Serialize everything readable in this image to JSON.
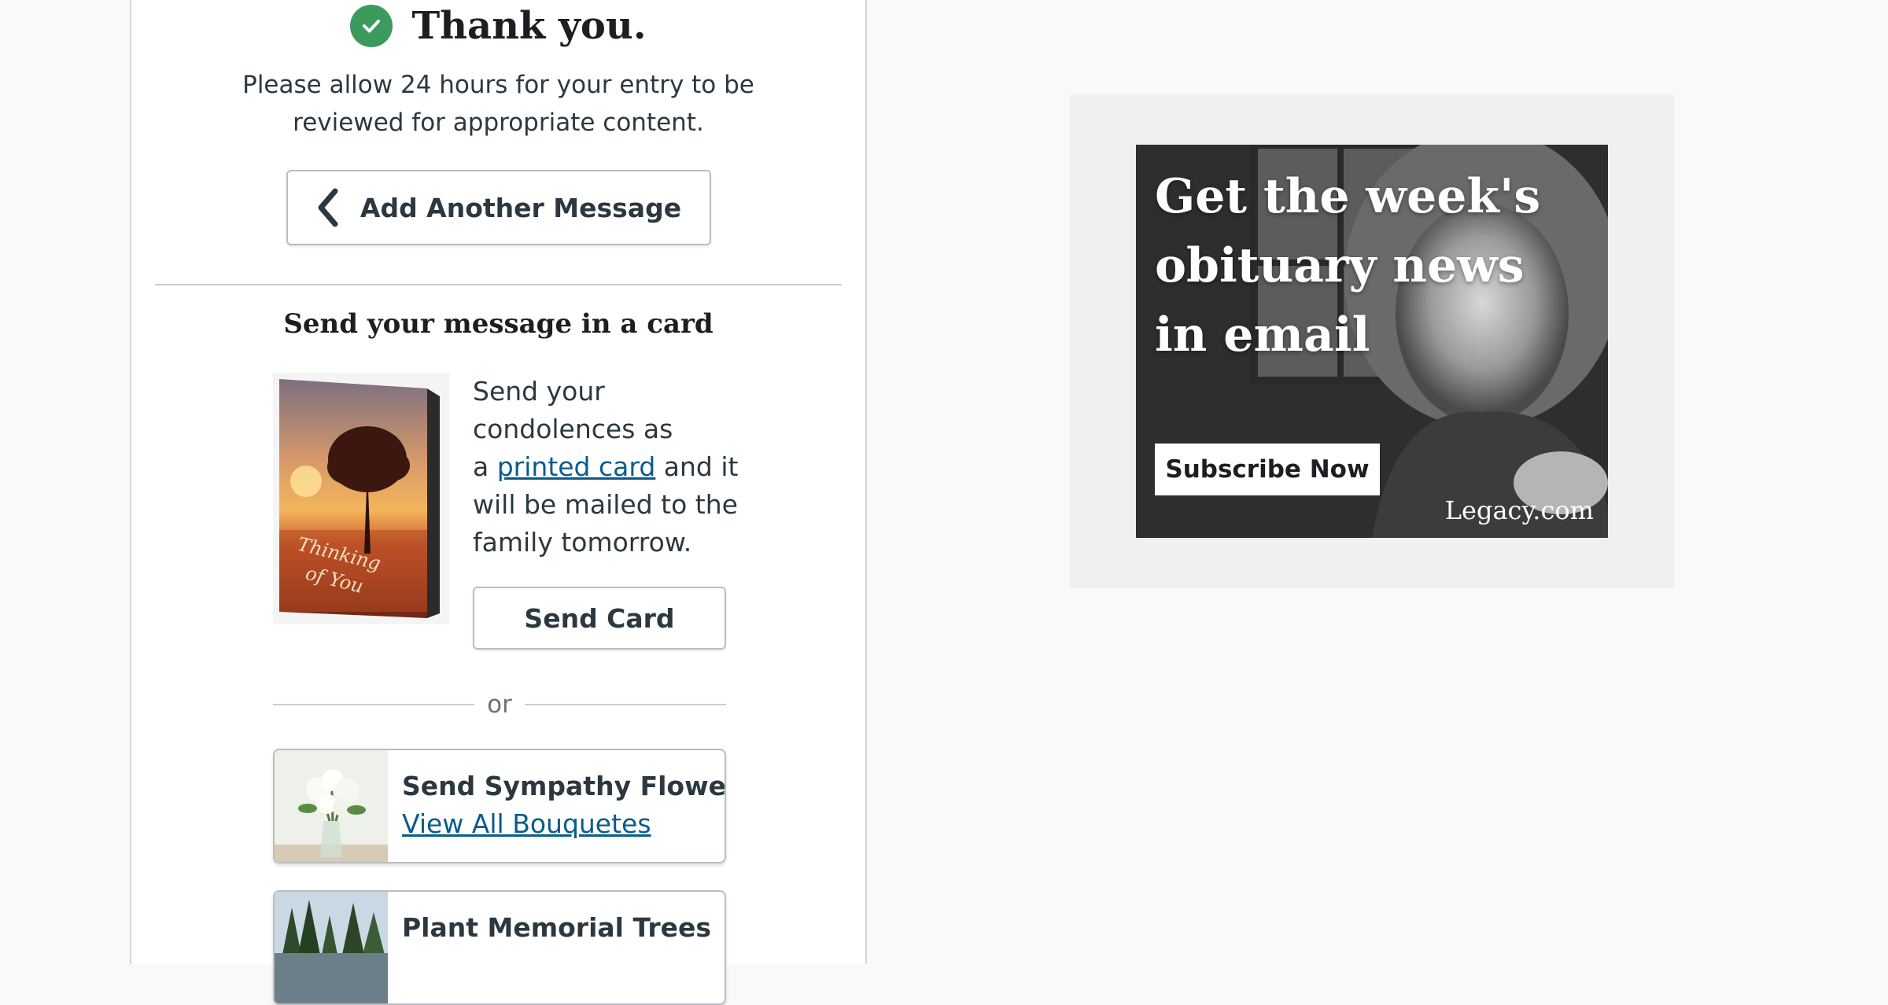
{
  "confirmation": {
    "title": "Thank you.",
    "note_line1": "Please allow 24 hours for your entry to be",
    "note_line2": "reviewed for appropriate content.",
    "add_another_label": "Add Another Message"
  },
  "card_section": {
    "heading": "Send your message in a card",
    "text_before_line1": "Send your",
    "text_before_line2": "condolences as",
    "text_a": "a ",
    "link_text": "printed card",
    "text_after": " and it",
    "text_line4": "will be mailed to the",
    "text_line5": "family tomorrow.",
    "send_card_label": "Send Card",
    "card_caption_line1": "Thinking",
    "card_caption_line2": "of You"
  },
  "separator": {
    "or_label": "or"
  },
  "tiles": [
    {
      "title": "Send Sympathy Flowers",
      "link": "View All Bouquetes"
    },
    {
      "title": "Plant Memorial Trees",
      "link": ""
    }
  ],
  "ad": {
    "headline_line1": "Get the week's",
    "headline_line2": "obituary news",
    "headline_line3": "in email",
    "cta_label": "Subscribe Now",
    "brand": "Legacy.com"
  },
  "colors": {
    "success_green": "#3d9a5d",
    "link_blue": "#0a5b8c",
    "text_dark": "#2c3840"
  },
  "icons": {
    "check": "check-circle-icon",
    "back": "chevron-left-icon"
  }
}
